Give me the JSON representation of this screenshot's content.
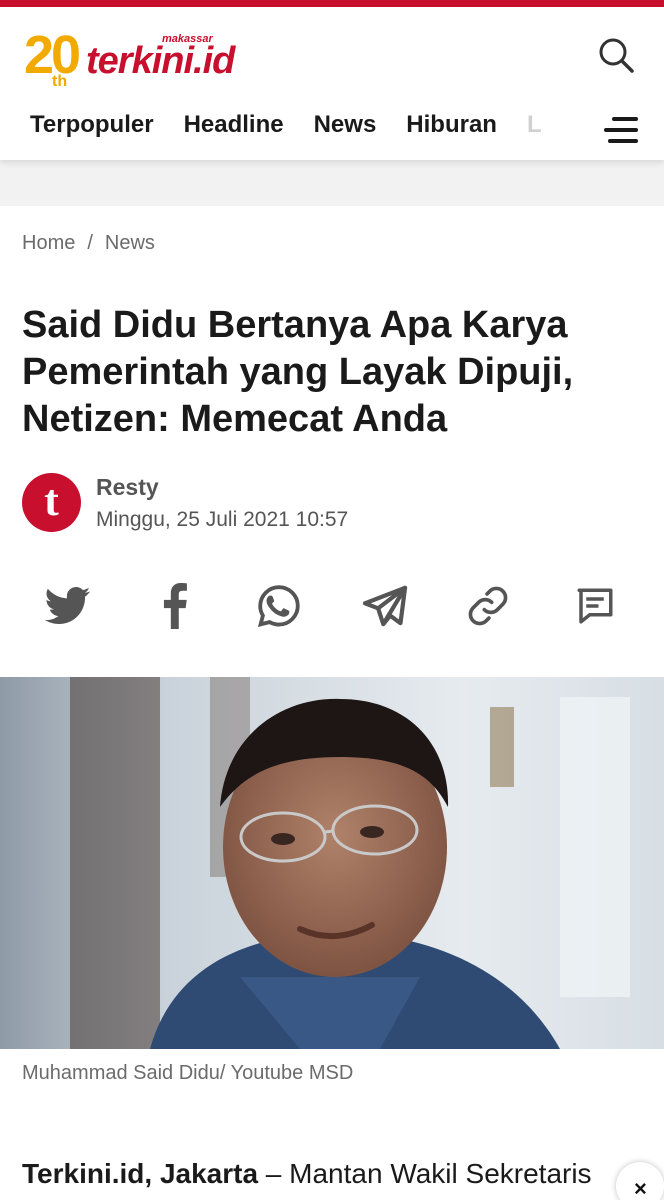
{
  "brand": {
    "anniversary": "20",
    "anniversary_suffix": "th",
    "city": "makassar",
    "name": "terkini.id",
    "primary_color": "#c8102e",
    "accent_color": "#f2a900"
  },
  "header": {
    "search_icon": "search-icon",
    "menu_icon": "hamburger-menu-icon"
  },
  "nav": {
    "items": [
      "Terpopuler",
      "Headline",
      "News",
      "Hiburan",
      "L"
    ]
  },
  "breadcrumb": {
    "home": "Home",
    "separator": "/",
    "current": "News"
  },
  "article": {
    "title": "Said Didu Bertanya Apa Karya Pemerintah yang Layak Dipuji, Netizen: Memecat Anda",
    "author_initial": "t",
    "author": "Resty",
    "date": "Minggu, 25 Juli 2021 10:57",
    "image_caption": "Muhammad Said Didu/ Youtube MSD",
    "lead_source": "Terkini.id, Jakarta",
    "lead_text": " – Mantan Wakil Sekretaris"
  },
  "share": {
    "icons": [
      "twitter-icon",
      "facebook-icon",
      "whatsapp-icon",
      "telegram-icon",
      "link-icon",
      "comment-icon"
    ]
  },
  "ad": {
    "close_label": "×"
  }
}
